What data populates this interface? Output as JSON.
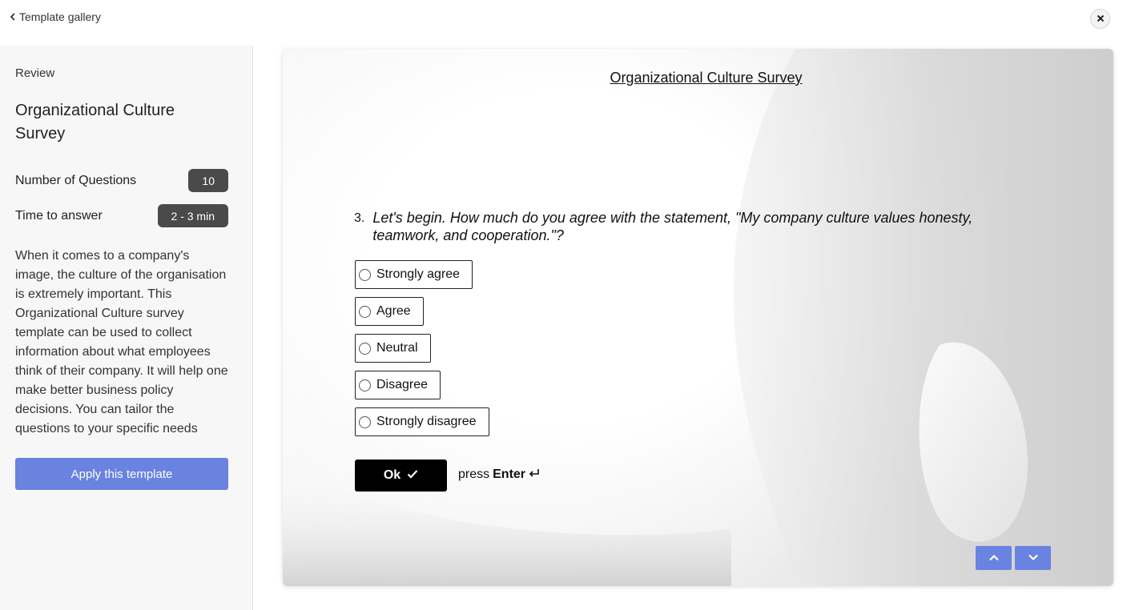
{
  "topbar": {
    "back_label": "Template gallery"
  },
  "sidebar": {
    "review_label": "Review",
    "title": "Organizational Culture Survey",
    "questions_label": "Number of Questions",
    "questions_value": "10",
    "time_label": "Time to answer",
    "time_value": "2 - 3 min",
    "description": "When it comes to a company's image, the culture of the organisation is extremely important. This Organizational Culture survey template can be used to collect information about what employees think of their company. It will help one make better business policy decisions. You can tailor the questions to your specific needs",
    "apply_label": "Apply this template"
  },
  "preview": {
    "form_title": "Organizational Culture Survey",
    "question_number": "3.",
    "question_text": "Let's begin. How much do you agree with the statement, \"My company culture values honesty, teamwork, and cooperation.\"?",
    "options": [
      {
        "label": "Strongly agree"
      },
      {
        "label": "Agree"
      },
      {
        "label": "Neutral"
      },
      {
        "label": "Disagree"
      },
      {
        "label": "Strongly disagree"
      }
    ],
    "ok_label": "Ok",
    "hint_prefix": "press",
    "hint_key": "Enter"
  },
  "colors": {
    "accent": "#6a82e0",
    "pill": "#4a4a4a",
    "ok_button": "#000000"
  },
  "icons": {
    "back": "chevron-left-icon",
    "close": "close-icon",
    "ok": "checkmark-icon",
    "enter": "enter-return-icon",
    "nav_up": "chevron-up-icon",
    "nav_down": "chevron-down-icon"
  }
}
